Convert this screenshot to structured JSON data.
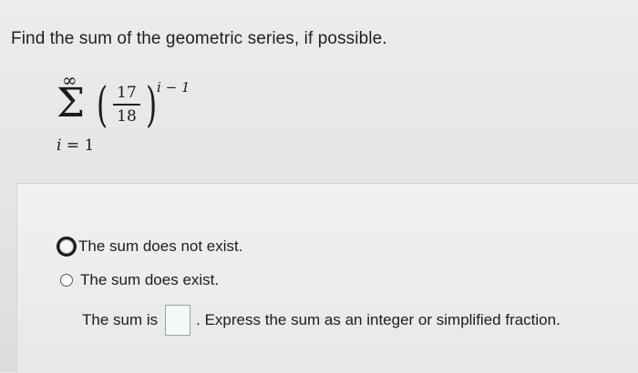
{
  "question": {
    "prompt": "Find the sum of the geometric series, if possible."
  },
  "series": {
    "upper_limit": "∞",
    "sigma": "Σ",
    "numerator": "17",
    "denominator": "18",
    "exponent": "i − 1",
    "lower_index": "i",
    "lower_eq": " = 1"
  },
  "options": [
    {
      "label": "The sum does not exist.",
      "selected": true
    },
    {
      "label": "The sum does exist.",
      "selected": false
    }
  ],
  "sum_line": {
    "prefix": "The sum is",
    "input_value": "",
    "suffix": ". Express the sum as an integer or simplified fraction."
  }
}
